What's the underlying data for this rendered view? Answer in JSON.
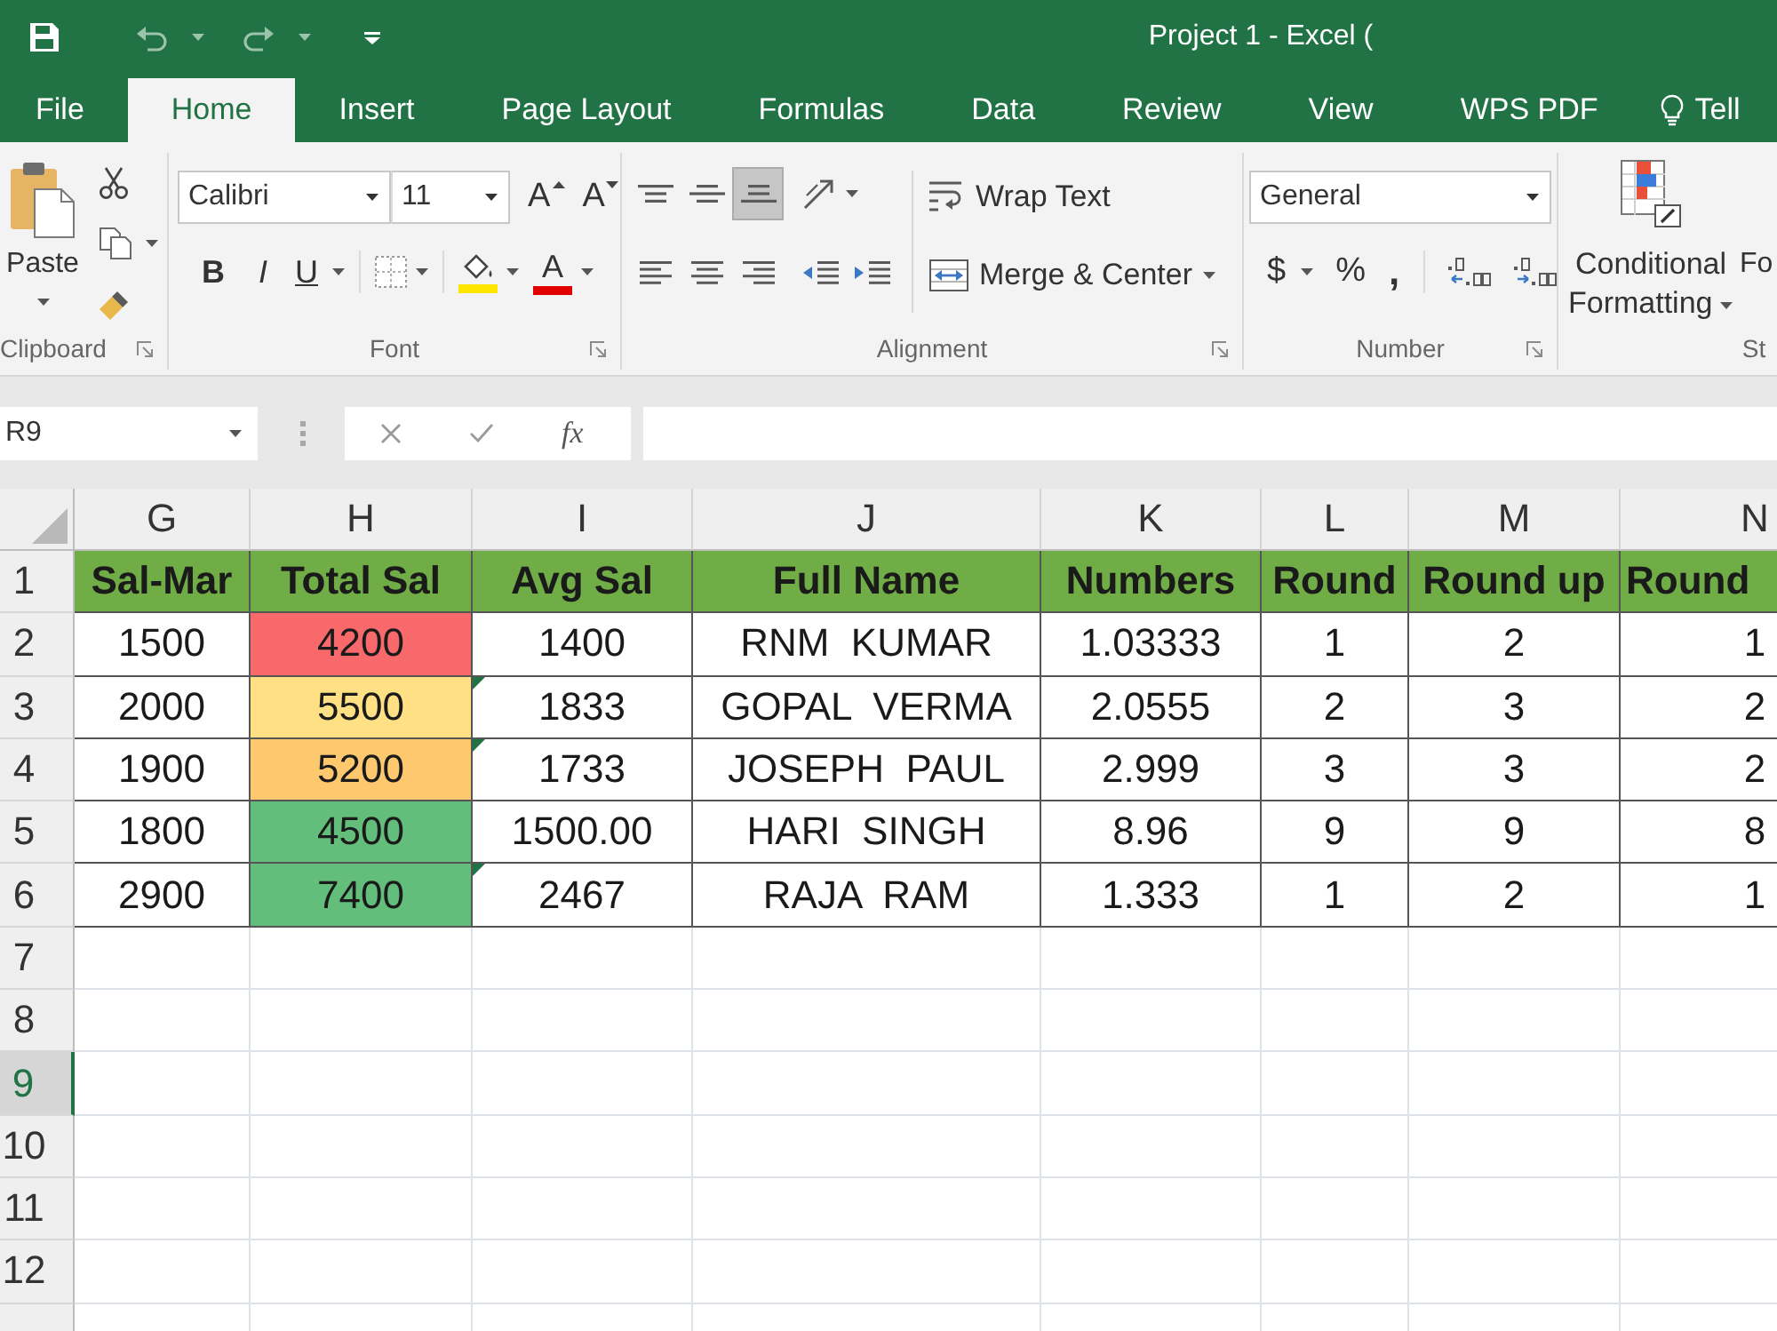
{
  "window": {
    "title": "Project 1 - Excel ("
  },
  "tabs": [
    {
      "label": "File",
      "selected": false
    },
    {
      "label": "Home",
      "selected": true
    },
    {
      "label": "Insert",
      "selected": false
    },
    {
      "label": "Page Layout",
      "selected": false
    },
    {
      "label": "Formulas",
      "selected": false
    },
    {
      "label": "Data",
      "selected": false
    },
    {
      "label": "Review",
      "selected": false
    },
    {
      "label": "View",
      "selected": false
    },
    {
      "label": "WPS PDF",
      "selected": false
    }
  ],
  "tell_me": {
    "label": "Tell"
  },
  "ribbon": {
    "clipboard": {
      "paste_label": "Paste",
      "group_label": "Clipboard"
    },
    "font": {
      "name": "Calibri",
      "size": "11",
      "grow_label": "A",
      "shrink_label": "A",
      "bold_label": "B",
      "italic_label": "I",
      "underline_label": "U",
      "fill_color": {
        "color": "#ffe600"
      },
      "font_color": {
        "label": "A",
        "color": "#e00000"
      },
      "group_label": "Font"
    },
    "alignment": {
      "vertical": [
        {
          "selected": false
        },
        {
          "selected": false
        },
        {
          "selected": true
        }
      ],
      "horizontal": [
        {
          "selected": false
        },
        {
          "selected": false
        },
        {
          "selected": false
        }
      ],
      "wrap_text": "Wrap Text",
      "merge_center": "Merge & Center",
      "group_label": "Alignment"
    },
    "number": {
      "format": "General",
      "currency_label": "$",
      "percent_label": "%",
      "comma_label": ",",
      "group_label": "Number"
    },
    "styles": {
      "conditional_formatting": "Conditional Formatting",
      "format_as_table": "Fo",
      "group_label": "St"
    }
  },
  "formula_bar": {
    "name_box": "R9",
    "function_label": "fx"
  },
  "sheet": {
    "columns": [
      {
        "label": "G",
        "selected": false
      },
      {
        "label": "H",
        "selected": false
      },
      {
        "label": "I",
        "selected": false
      },
      {
        "label": "J",
        "selected": false
      },
      {
        "label": "K",
        "selected": false
      },
      {
        "label": "L",
        "selected": false
      },
      {
        "label": "M",
        "selected": false
      },
      {
        "label": "N",
        "selected": false
      }
    ],
    "rows": [
      {
        "header": "1",
        "selected": false,
        "kind": "header",
        "cells": [
          {
            "text": "Sal-Mar",
            "flagged": false
          },
          {
            "text": "Total Sal",
            "flagged": false
          },
          {
            "text": "Avg Sal",
            "flagged": false
          },
          {
            "text": "Full Name",
            "flagged": false
          },
          {
            "text": "Numbers",
            "flagged": false
          },
          {
            "text": "Round",
            "flagged": false
          },
          {
            "text": "Round up",
            "flagged": false
          },
          {
            "text": "Round",
            "flagged": false
          }
        ]
      },
      {
        "header": "2",
        "selected": false,
        "kind": "data",
        "cells": [
          {
            "text": "1500",
            "flagged": false
          },
          {
            "text": "4200",
            "color": "#f8696b",
            "flagged": false
          },
          {
            "text": "1400",
            "flagged": false
          },
          {
            "text": "RNM  KUMAR",
            "flagged": false
          },
          {
            "text": "1.03333",
            "flagged": false
          },
          {
            "text": "1",
            "flagged": false
          },
          {
            "text": "2",
            "flagged": false
          },
          {
            "text": "1",
            "flagged": false
          }
        ]
      },
      {
        "header": "3",
        "selected": false,
        "kind": "data",
        "cells": [
          {
            "text": "2000",
            "flagged": false
          },
          {
            "text": "5500",
            "color": "#ffe084",
            "flagged": false
          },
          {
            "text": "1833",
            "flagged": true
          },
          {
            "text": "GOPAL  VERMA",
            "flagged": false
          },
          {
            "text": "2.0555",
            "flagged": false
          },
          {
            "text": "2",
            "flagged": false
          },
          {
            "text": "3",
            "flagged": false
          },
          {
            "text": "2",
            "flagged": false
          }
        ]
      },
      {
        "header": "4",
        "selected": false,
        "kind": "data",
        "cells": [
          {
            "text": "1900",
            "flagged": false
          },
          {
            "text": "5200",
            "color": "#fdc86e",
            "flagged": false
          },
          {
            "text": "1733",
            "flagged": true
          },
          {
            "text": "JOSEPH  PAUL",
            "flagged": false
          },
          {
            "text": "2.999",
            "flagged": false
          },
          {
            "text": "3",
            "flagged": false
          },
          {
            "text": "3",
            "flagged": false
          },
          {
            "text": "2",
            "flagged": false
          }
        ]
      },
      {
        "header": "5",
        "selected": false,
        "kind": "data",
        "cells": [
          {
            "text": "1800",
            "flagged": false
          },
          {
            "text": "4500",
            "color": "#63be7b",
            "flagged": false
          },
          {
            "text": "1500.00",
            "flagged": false
          },
          {
            "text": "HARI  SINGH",
            "flagged": false
          },
          {
            "text": "8.96",
            "flagged": false
          },
          {
            "text": "9",
            "flagged": false
          },
          {
            "text": "9",
            "flagged": false
          },
          {
            "text": "8",
            "flagged": false
          }
        ]
      },
      {
        "header": "6",
        "selected": false,
        "kind": "data",
        "cells": [
          {
            "text": "2900",
            "flagged": false
          },
          {
            "text": "7400",
            "color": "#63be7b",
            "flagged": false
          },
          {
            "text": "2467",
            "flagged": true
          },
          {
            "text": "RAJA  RAM",
            "flagged": false
          },
          {
            "text": "1.333",
            "flagged": false
          },
          {
            "text": "1",
            "flagged": false
          },
          {
            "text": "2",
            "flagged": false
          },
          {
            "text": "1",
            "flagged": false
          }
        ]
      },
      {
        "header": "7",
        "selected": false,
        "kind": "empty"
      },
      {
        "header": "8",
        "selected": false,
        "kind": "empty"
      },
      {
        "header": "9",
        "selected": true,
        "kind": "empty"
      },
      {
        "header": "10",
        "selected": false,
        "kind": "empty"
      },
      {
        "header": "11",
        "selected": false,
        "kind": "empty"
      },
      {
        "header": "12",
        "selected": false,
        "kind": "empty"
      }
    ]
  }
}
